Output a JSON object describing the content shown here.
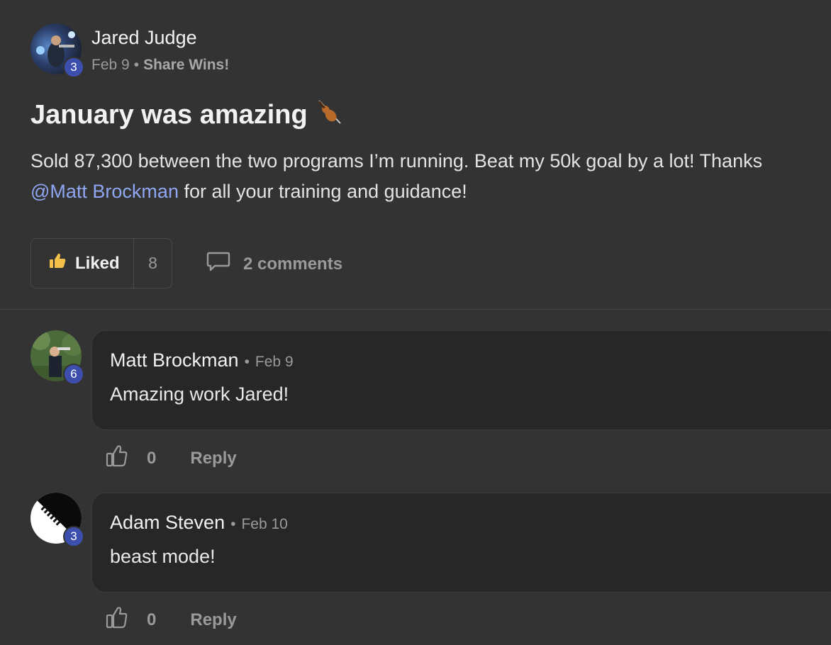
{
  "post": {
    "author": "Jared Judge",
    "level": "3",
    "date": "Feb 9",
    "separator": "•",
    "category": "Share Wins!",
    "title": "January was amazing",
    "title_emoji": "🎻",
    "body_text": "Sold 87,300 between the two programs I’m running. Beat my 50k goal by a lot! Thanks",
    "mention": "@Matt Brockman",
    "body_tail": " for all your training and guidance!",
    "like_label": "Liked",
    "like_count": "8",
    "comments_label": "2 comments"
  },
  "comments": [
    {
      "author": "Matt Brockman",
      "separator": "•",
      "date": "Feb 9",
      "level": "6",
      "text": "Amazing work Jared!",
      "likes": "0",
      "reply_label": "Reply"
    },
    {
      "author": "Adam Steven",
      "separator": "•",
      "date": "Feb 10",
      "level": "3",
      "text": "beast mode!",
      "likes": "0",
      "reply_label": "Reply"
    }
  ],
  "colors": {
    "background": "#333333",
    "badge": "#3d4fae",
    "mention": "#8fa6f2",
    "bubble": "#272727",
    "like_icon": "#f5c04a"
  },
  "icons": [
    "thumbs-up-filled-icon",
    "comment-bubble-icon",
    "thumbs-up-outline-icon",
    "violin-emoji-icon"
  ]
}
